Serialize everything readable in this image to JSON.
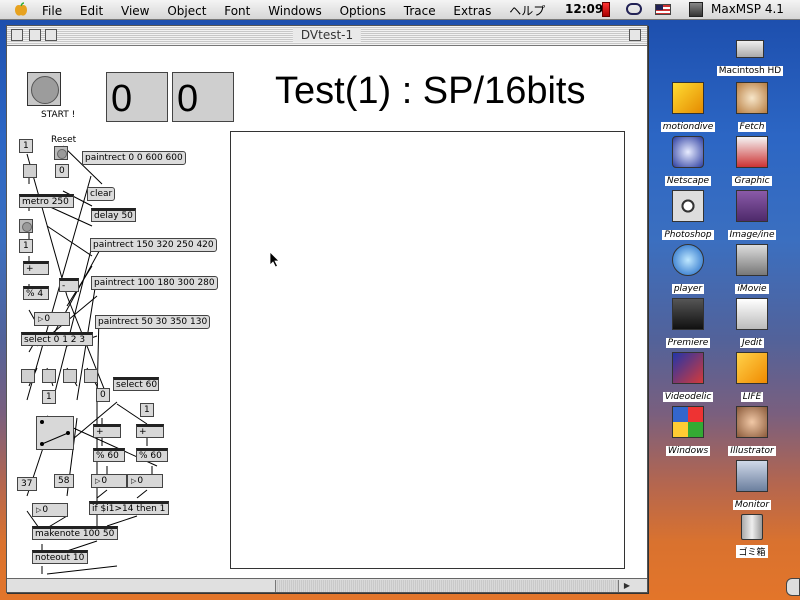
{
  "menubar": {
    "items": [
      "File",
      "Edit",
      "View",
      "Object",
      "Font",
      "Windows",
      "Options",
      "Trace",
      "Extras",
      "ヘルプ"
    ],
    "clock": "12:09",
    "app_name": "MaxMSP 4.1"
  },
  "window": {
    "title": "DVtest-1"
  },
  "patch": {
    "start_label": "START !",
    "reset_label": "Reset",
    "display_left": "0",
    "display_right": "0",
    "heading": "Test(1) : SP/16bits",
    "messages": {
      "paintrect_full": "paintrect 0 0 600 600",
      "clear": "clear",
      "paintrect_a": "paintrect 150 320 250 420",
      "paintrect_b": "paintrect 100 180 300 280",
      "paintrect_c": "paintrect 50 30 350 130"
    },
    "objects": {
      "metro": "metro 250",
      "delay": "delay 50",
      "plus": "+",
      "mod4": "% 4",
      "minus": "-",
      "select0123": "select 0 1 2 3",
      "select60": "select 60",
      "plus_a": "+",
      "plus_b": "+",
      "mod60_a": "% 60",
      "mod60_b": "% 60",
      "if_expr": "if $i1>14 then 1",
      "makenote": "makenote 100 50",
      "noteout": "noteout 10"
    },
    "numbers": {
      "n1": "1",
      "n_reset": "0",
      "n_1b": "1",
      "n_zero": "0",
      "n_1c": "1",
      "n_0b": "0",
      "n_1d": "1",
      "n_37": "37",
      "n_58": "58",
      "n_out_a": "0",
      "n_out_b": "0",
      "n_final": "0"
    }
  },
  "desktop_icons": [
    {
      "label": "Macintosh HD",
      "italic": false
    },
    {
      "label": "motiondive",
      "italic": true
    },
    {
      "label": "Fetch",
      "italic": true
    },
    {
      "label": "Netscape",
      "italic": true
    },
    {
      "label": "Graphic",
      "italic": true
    },
    {
      "label": "Photoshop",
      "italic": true
    },
    {
      "label": "Image/ine",
      "italic": true
    },
    {
      "label": "player",
      "italic": true
    },
    {
      "label": "iMovie",
      "italic": true
    },
    {
      "label": "Premiere",
      "italic": true
    },
    {
      "label": "Jedit",
      "italic": true
    },
    {
      "label": "Videodelic",
      "italic": true
    },
    {
      "label": "LIFE",
      "italic": true
    },
    {
      "label": "Windows",
      "italic": true
    },
    {
      "label": "Illustrator",
      "italic": true
    },
    {
      "label": "Monitor",
      "italic": true
    },
    {
      "label": "ゴミ箱",
      "italic": false
    }
  ]
}
